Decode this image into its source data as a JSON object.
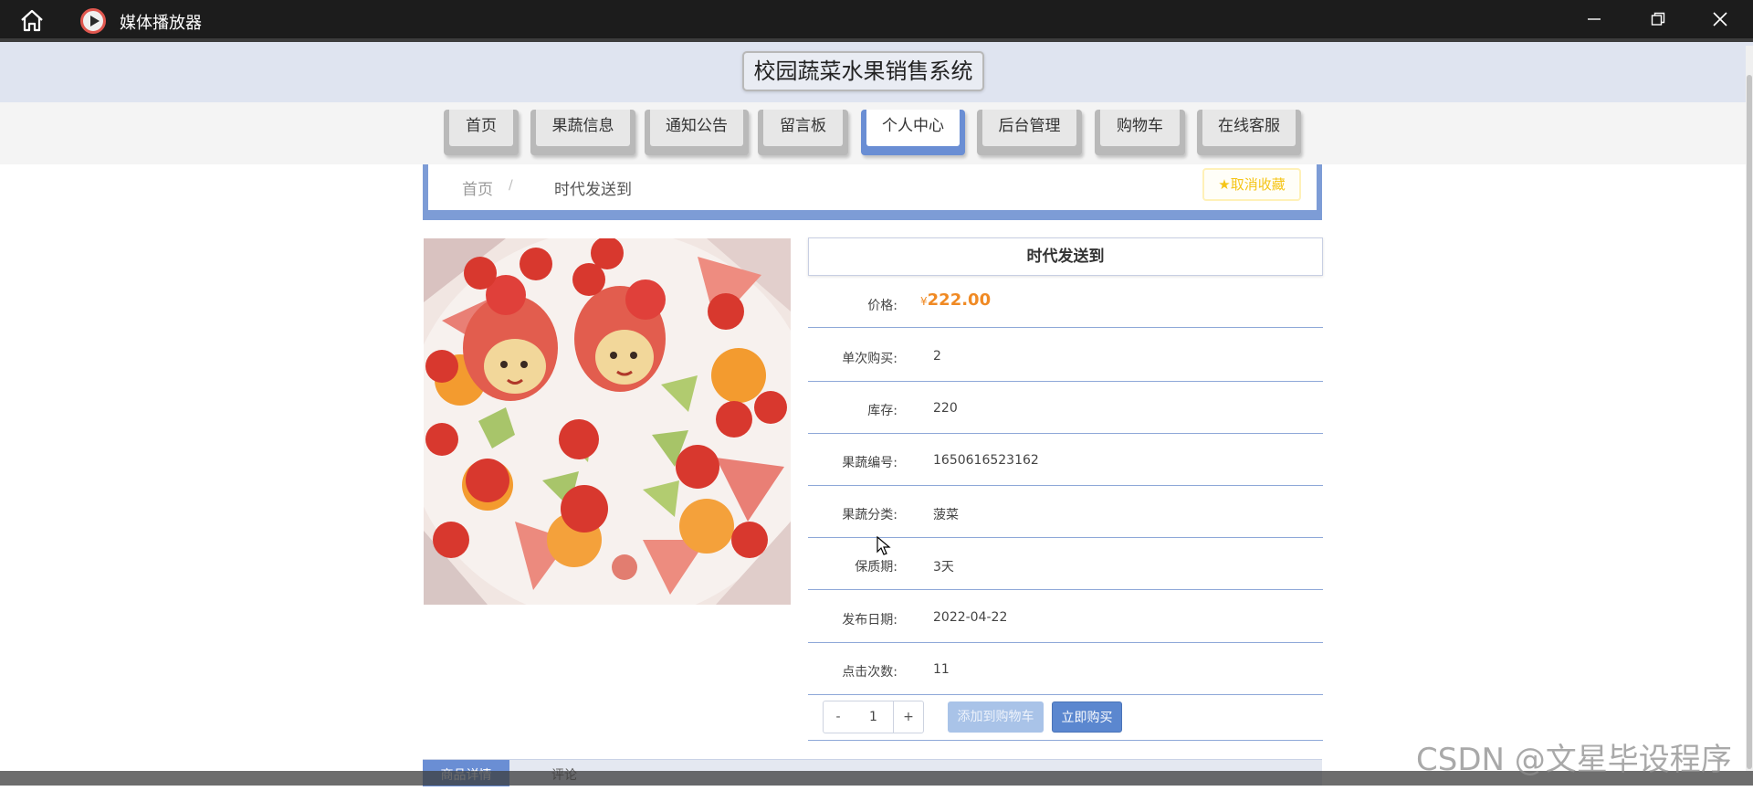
{
  "window": {
    "title": "媒体播放器",
    "home_icon": "home-icon",
    "app_icon": "media-player-icon"
  },
  "site": {
    "title": "校园蔬菜水果销售系统",
    "nav": [
      {
        "label": "首页"
      },
      {
        "label": "果蔬信息"
      },
      {
        "label": "通知公告"
      },
      {
        "label": "留言板"
      },
      {
        "label": "个人中心",
        "active": true
      },
      {
        "label": "后台管理"
      },
      {
        "label": "购物车"
      },
      {
        "label": "在线客服"
      }
    ]
  },
  "breadcrumb": {
    "home": "首页",
    "separator": "/",
    "current": "时代发送到"
  },
  "favorite": {
    "label": "取消收藏",
    "icon": "star-icon"
  },
  "product": {
    "name": "时代发送到",
    "image_alt": "fruit-platter",
    "price": {
      "label": "价格:",
      "currency": "¥",
      "value": "222.00"
    },
    "fields": [
      {
        "label": "单次购买:",
        "value": "2"
      },
      {
        "label": "库存:",
        "value": "220"
      },
      {
        "label": "果蔬编号:",
        "value": "1650616523162"
      },
      {
        "label": "果蔬分类:",
        "value": "菠菜"
      },
      {
        "label": "保质期:",
        "value": "3天"
      },
      {
        "label": "发布日期:",
        "value": "2022-04-22"
      },
      {
        "label": "点击次数:",
        "value": "11"
      }
    ]
  },
  "actions": {
    "minus": "-",
    "quantity": "1",
    "plus": "+",
    "add_to_cart": "添加到购物车",
    "buy_now": "立即购买"
  },
  "tabs": [
    {
      "label": "商品详情",
      "active": true
    },
    {
      "label": "评论"
    }
  ],
  "watermark": "CSDN @文星毕设程序",
  "colors": {
    "accent": "#6a8ed4",
    "price": "#f08a24",
    "favorite": "#f5c518"
  }
}
